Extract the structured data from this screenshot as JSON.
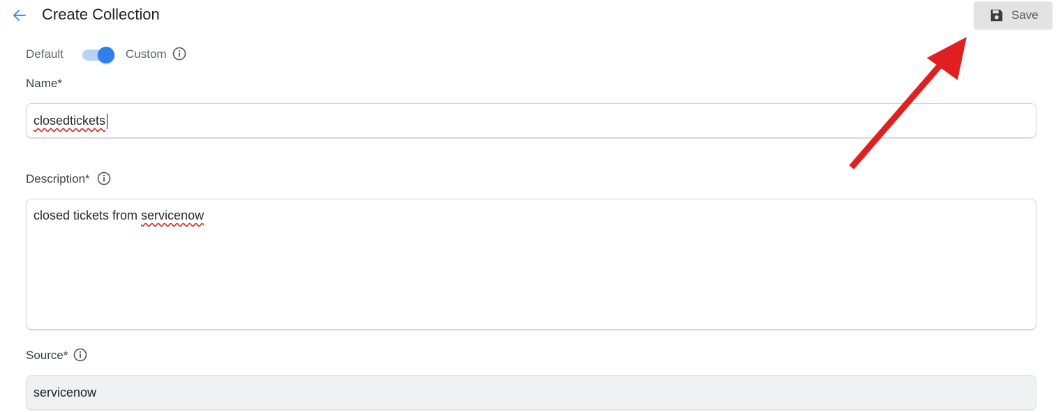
{
  "header": {
    "title": "Create Collection",
    "save_label": "Save"
  },
  "mode_toggle": {
    "left_label": "Default",
    "right_label": "Custom",
    "state": "Custom"
  },
  "form": {
    "name": {
      "label": "Name*",
      "value": "closedtickets"
    },
    "description": {
      "label": "Description*",
      "value_prefix": "closed tickets from ",
      "value_flagged": "servicenow"
    },
    "source": {
      "label": "Source*",
      "value": "servicenow"
    }
  },
  "icons": {
    "back": "arrow-left-icon",
    "save": "floppy-disk-icon",
    "info": "info-circle-icon"
  },
  "colors": {
    "accent": "#2f80ed",
    "annotation_arrow": "#e02020",
    "spellcheck": "#d33"
  }
}
